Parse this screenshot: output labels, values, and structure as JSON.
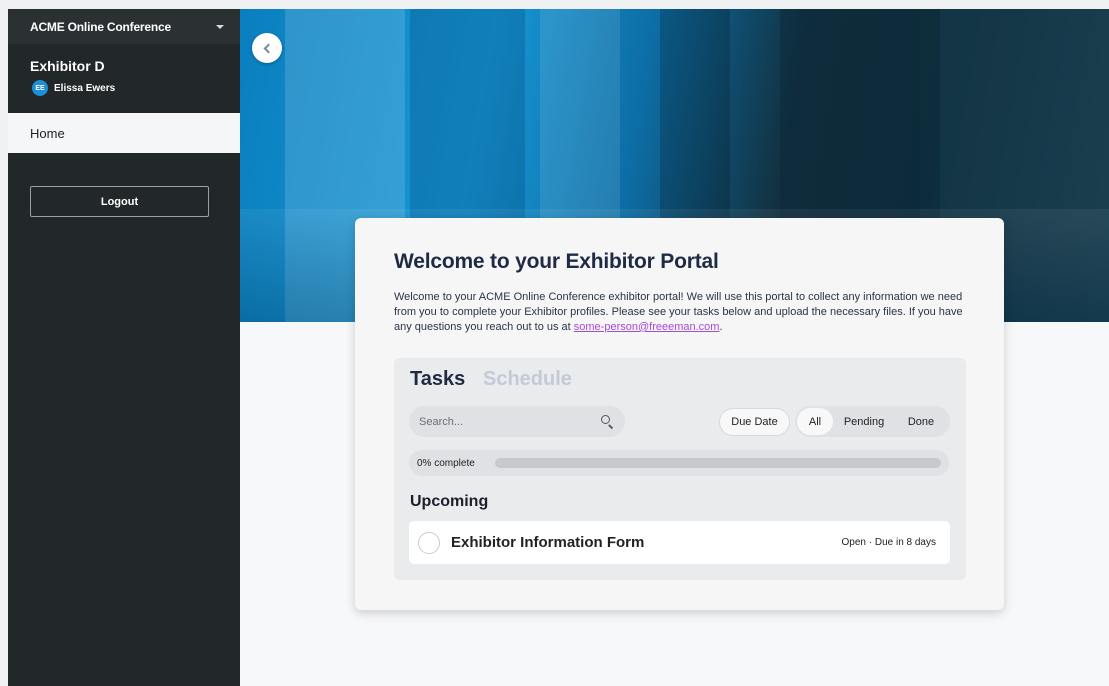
{
  "sidebar": {
    "conference_name": "ACME Online Conference",
    "exhibitor_name": "Exhibitor D",
    "user_initials": "EE",
    "user_name": "Elissa Ewers",
    "nav": [
      {
        "label": "Home"
      }
    ],
    "logout_label": "Logout"
  },
  "card": {
    "title": "Welcome to your Exhibitor Portal",
    "description": "Welcome to your ACME Online Conference exhibitor portal! We will use this portal to collect any information we need from you to complete your Exhibitor profiles. Please see your tasks below and upload the necessary files. If you have any questions you reach out to us at ",
    "contact_email": "some-person@freeeman.com",
    "description_end": "."
  },
  "tasks": {
    "tab_tasks": "Tasks",
    "tab_schedule": "Schedule",
    "search_placeholder": "Search...",
    "due_date_label": "Due Date",
    "filters": {
      "all": "All",
      "pending": "Pending",
      "done": "Done"
    },
    "progress_label": "0% complete",
    "progress_value": 0,
    "upcoming_heading": "Upcoming",
    "items": [
      {
        "name": "Exhibitor Information Form",
        "status": "Open · Due in 8 days"
      }
    ]
  },
  "colors": {
    "sidebar_bg": "#222729",
    "accent": "#1d8fd6",
    "title": "#1f2b45",
    "link": "#a54bd6"
  },
  "icons": {
    "conference_dropdown": "caret-down-icon",
    "back": "chevron-left-icon",
    "search": "search-icon",
    "task_status": "circle-icon"
  }
}
